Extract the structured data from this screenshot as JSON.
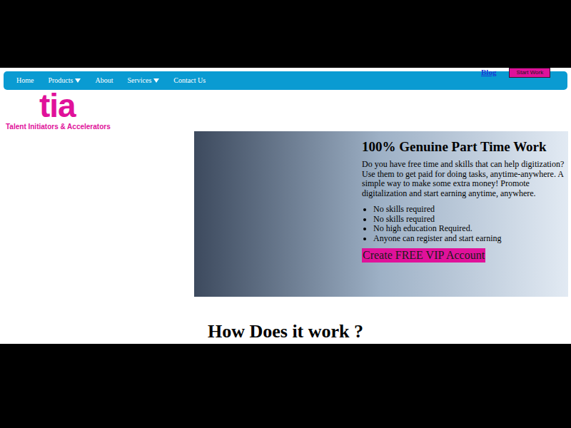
{
  "nav": {
    "items": [
      {
        "label": "Home",
        "dropdown": false
      },
      {
        "label": "Products",
        "dropdown": true
      },
      {
        "label": "About",
        "dropdown": false
      },
      {
        "label": "Services",
        "dropdown": true
      },
      {
        "label": "Contact Us",
        "dropdown": false
      }
    ]
  },
  "top_links": {
    "blog": "Blog",
    "start_button": "Start Work"
  },
  "logo": {
    "mark": "tia",
    "tagline": "Talent Initiators & Accelerators"
  },
  "hero": {
    "heading": "100% Genuine Part Time Work",
    "text": "Do you have free time and skills that can help digitization? Use them to get paid for doing tasks, anytime-anywhere. A simple way to make some extra money! Promote digitalization and start earning anytime, anywhere.",
    "bullets": [
      "No skills required",
      "No skills required",
      "No high education Required.",
      "Anyone can register and start earning"
    ],
    "cta": "Create FREE VIP Account"
  },
  "section_title": "How Does it work ?"
}
